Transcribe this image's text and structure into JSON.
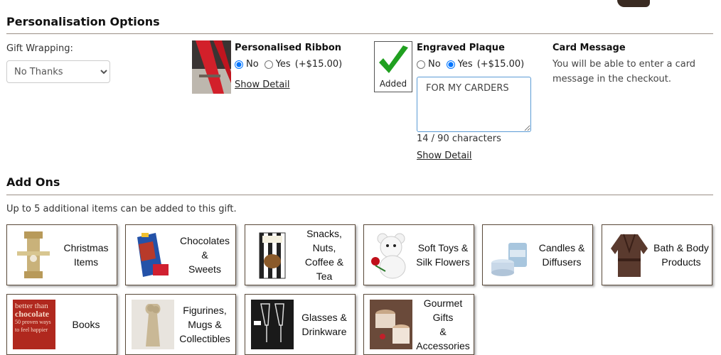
{
  "personalisation": {
    "heading": "Personalisation Options",
    "gift_wrapping_label": "Gift Wrapping:",
    "gift_wrapping_value": "No Thanks",
    "ribbon": {
      "title": "Personalised Ribbon",
      "no_label": "No",
      "yes_label": "Yes",
      "price": "(+$15.00)",
      "selected": "No",
      "detail_link": "Show Detail"
    },
    "plaque": {
      "badge": "Added",
      "title": "Engraved Plaque",
      "no_label": "No",
      "yes_label": "Yes",
      "price": "(+$15.00)",
      "selected": "Yes",
      "text_value": "FOR MY CARDERS",
      "char_count": "14 / 90 characters",
      "detail_link": "Show Detail"
    },
    "card": {
      "title": "Card Message",
      "line1": "You will be able to enter a card",
      "line2": "message in the checkout."
    }
  },
  "addons": {
    "heading": "Add Ons",
    "note": "Up to 5 additional items can be added to this gift.",
    "categories": [
      {
        "line1": "Christmas",
        "line2": "Items",
        "line3": ""
      },
      {
        "line1": "Chocolates &",
        "line2": "Sweets",
        "line3": ""
      },
      {
        "line1": "Snacks, Nuts,",
        "line2": "Coffee & Tea",
        "line3": ""
      },
      {
        "line1": "Soft Toys &",
        "line2": "Silk Flowers",
        "line3": ""
      },
      {
        "line1": "Candles &",
        "line2": "Diffusers",
        "line3": ""
      },
      {
        "line1": "Bath & Body",
        "line2": "Products",
        "line3": ""
      },
      {
        "line1": "Books",
        "line2": "",
        "line3": ""
      },
      {
        "line1": "Figurines,",
        "line2": "Mugs &",
        "line3": "Collectibles"
      },
      {
        "line1": "Glasses &",
        "line2": "Drinkware",
        "line3": ""
      },
      {
        "line1": "Gourmet Gifts",
        "line2": "& Accessories",
        "line3": ""
      }
    ],
    "book_cover_text": {
      "a": "better than",
      "b": "chocolate",
      "c": "50 proven ways",
      "d": "to feel happier"
    }
  }
}
